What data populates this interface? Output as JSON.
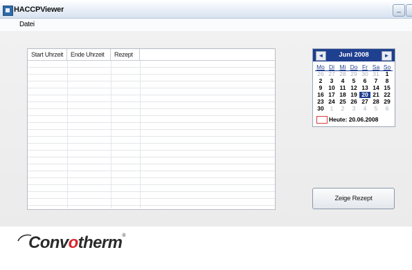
{
  "window": {
    "title": "HACCPViewer"
  },
  "menu": {
    "items": [
      "Datei"
    ]
  },
  "table": {
    "columns": [
      "Start Uhrzeit",
      "Ende Uhrzeit",
      "Rezept",
      ""
    ],
    "rows": []
  },
  "calendar": {
    "title": "Juni 2008",
    "prev_label": "◄",
    "next_label": "►",
    "weekdays": [
      "Mo",
      "Di",
      "Mi",
      "Do",
      "Fr",
      "Sa",
      "So"
    ],
    "weeks": [
      [
        "26",
        "27",
        "28",
        "29",
        "30",
        "31",
        "1"
      ],
      [
        "2",
        "3",
        "4",
        "5",
        "6",
        "7",
        "8"
      ],
      [
        "9",
        "10",
        "11",
        "12",
        "13",
        "14",
        "15"
      ],
      [
        "16",
        "17",
        "18",
        "19",
        "20",
        "21",
        "22"
      ],
      [
        "23",
        "24",
        "25",
        "26",
        "27",
        "28",
        "29"
      ],
      [
        "30",
        "1",
        "2",
        "3",
        "4",
        "5",
        "6"
      ]
    ],
    "selected_day": "20",
    "today_label": "Heute: 20.06.2008",
    "accent_color": "#1f3f8f"
  },
  "actions": {
    "show_recipe": "Zeige Rezept"
  },
  "logo": {
    "part1": "Conv",
    "part2": "o",
    "part3": "therm",
    "tm": "®",
    "brand_color": "#d7262d"
  }
}
